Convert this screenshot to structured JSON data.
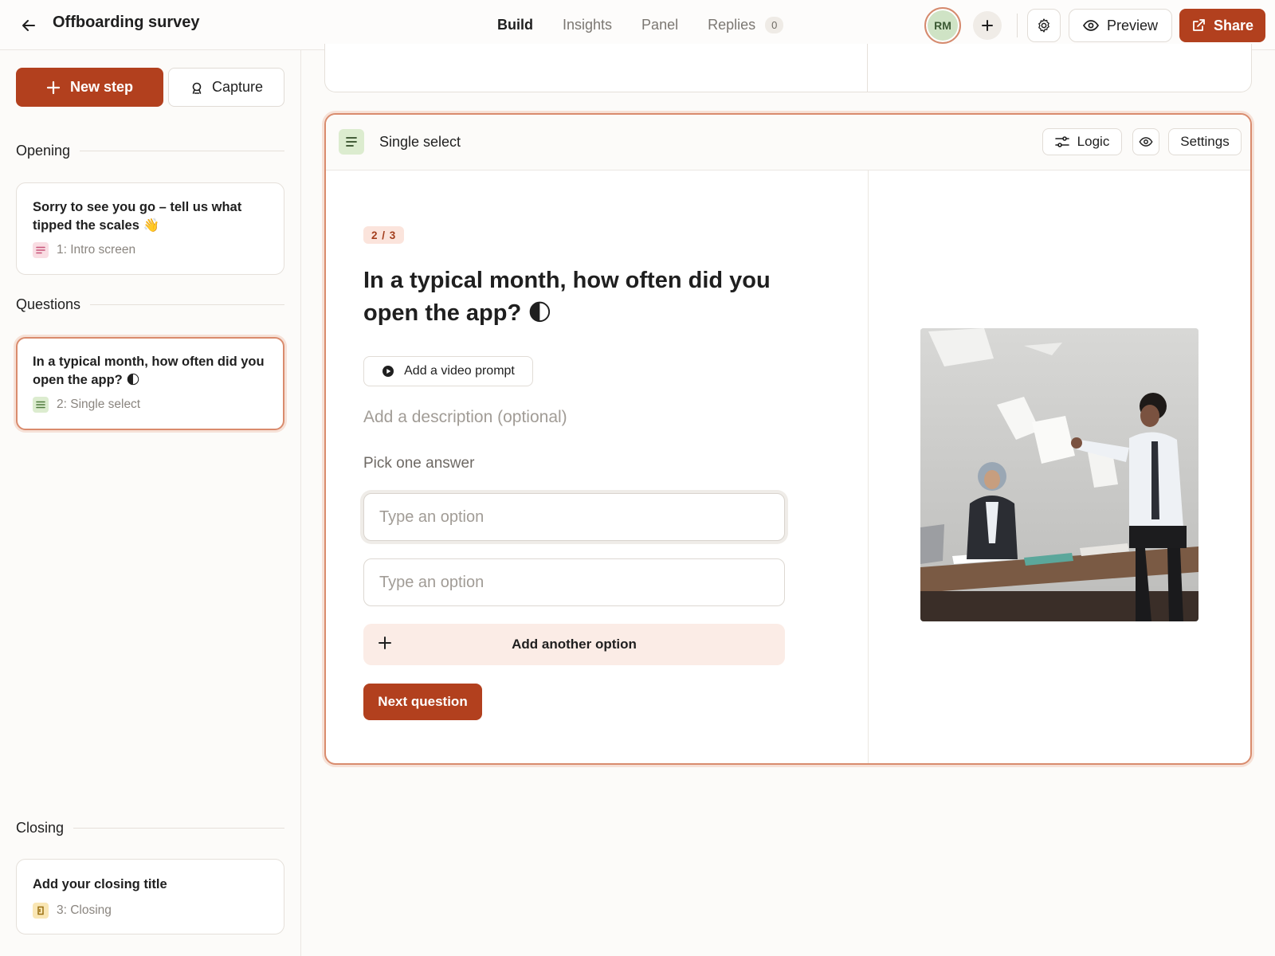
{
  "header": {
    "title": "Offboarding survey",
    "tabs": [
      {
        "label": "Build"
      },
      {
        "label": "Insights"
      },
      {
        "label": "Panel"
      },
      {
        "label": "Replies",
        "count": "0"
      }
    ],
    "avatar_initials": "RM",
    "preview_label": "Preview",
    "share_label": "Share"
  },
  "sidebar": {
    "new_step_label": "New step",
    "capture_label": "Capture",
    "sections": [
      {
        "title": "Opening",
        "steps": [
          {
            "text": "Sorry to see you go – tell us what tipped the scales 👋",
            "meta": "1: Intro screen"
          }
        ]
      },
      {
        "title": "Questions",
        "steps": [
          {
            "text": "In a typical month, how often did you open the app? 🌓",
            "meta": "2: Single select"
          }
        ]
      },
      {
        "title": "Closing",
        "steps": [
          {
            "text": "Add your closing title",
            "meta": "3: Closing"
          }
        ]
      }
    ]
  },
  "editor": {
    "type_label": "Single select",
    "logic_label": "Logic",
    "settings_label": "Settings",
    "counter": "2 / 3",
    "question": "In a typical month, how often did you open the app? 🌓",
    "video_prompt_label": "Add a video prompt",
    "description_placeholder": "Add a description (optional)",
    "pick_label": "Pick one answer",
    "options": [
      {
        "value": "",
        "placeholder": "Type an option"
      },
      {
        "value": "",
        "placeholder": "Type an option"
      }
    ],
    "add_option_label": "Add another option",
    "next_label": "Next question"
  },
  "colors": {
    "accent": "#b2401e",
    "selection_border": "#d98b6d",
    "background": "#fcfbf9"
  }
}
